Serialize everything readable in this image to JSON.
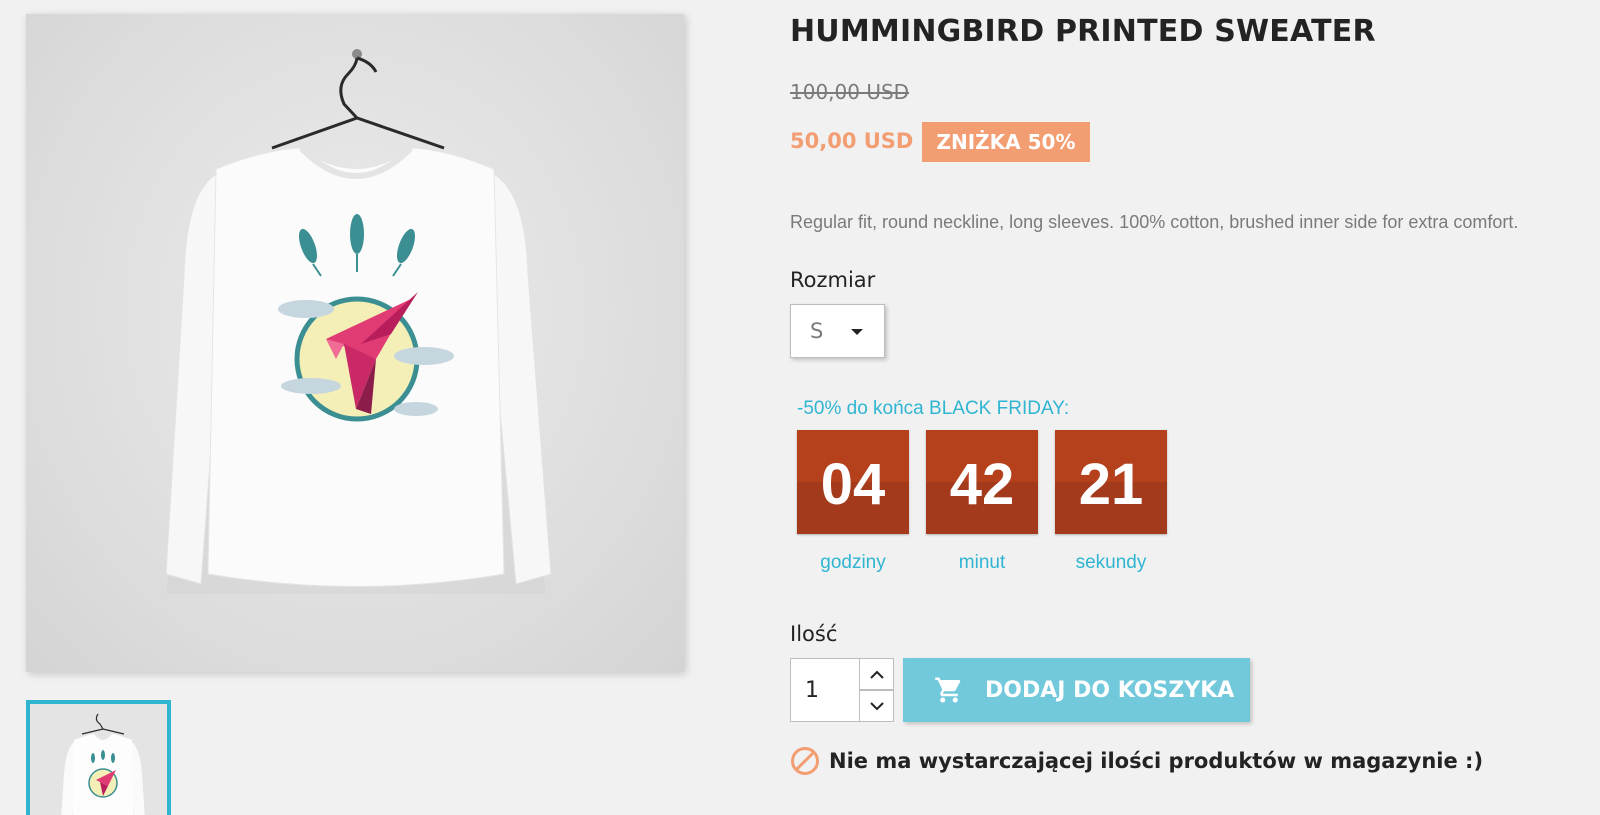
{
  "product": {
    "title": "HUMMINGBIRD PRINTED SWEATER",
    "regular_price": "100,00 USD",
    "current_price": "50,00 USD",
    "discount_badge": "ZNIŻKA 50%",
    "description": "Regular fit, round neckline, long sleeves. 100% cotton, brushed inner side for extra comfort."
  },
  "size": {
    "label": "Rozmiar",
    "selected": "S"
  },
  "countdown": {
    "title": "-50% do końca BLACK FRIDAY:",
    "units": [
      {
        "value": "04",
        "label": "godziny"
      },
      {
        "value": "42",
        "label": "minut"
      },
      {
        "value": "21",
        "label": "sekundy"
      }
    ]
  },
  "quantity": {
    "label": "Ilość",
    "value": "1"
  },
  "cart": {
    "button_label": "DODAJ DO KOSZYKA"
  },
  "stock": {
    "message": "Nie ma wystarczającej ilości produktów w magazynie :)"
  },
  "colors": {
    "accent": "#2fb5d2",
    "price": "#f39d72",
    "countdown_box": "#b5401c",
    "cart_button": "#72c9dc"
  },
  "icons": {
    "cart": "cart-icon",
    "stock": "ban-icon",
    "qty_up": "chevron-up-icon",
    "qty_down": "chevron-down-icon",
    "select": "caret-down-icon"
  }
}
